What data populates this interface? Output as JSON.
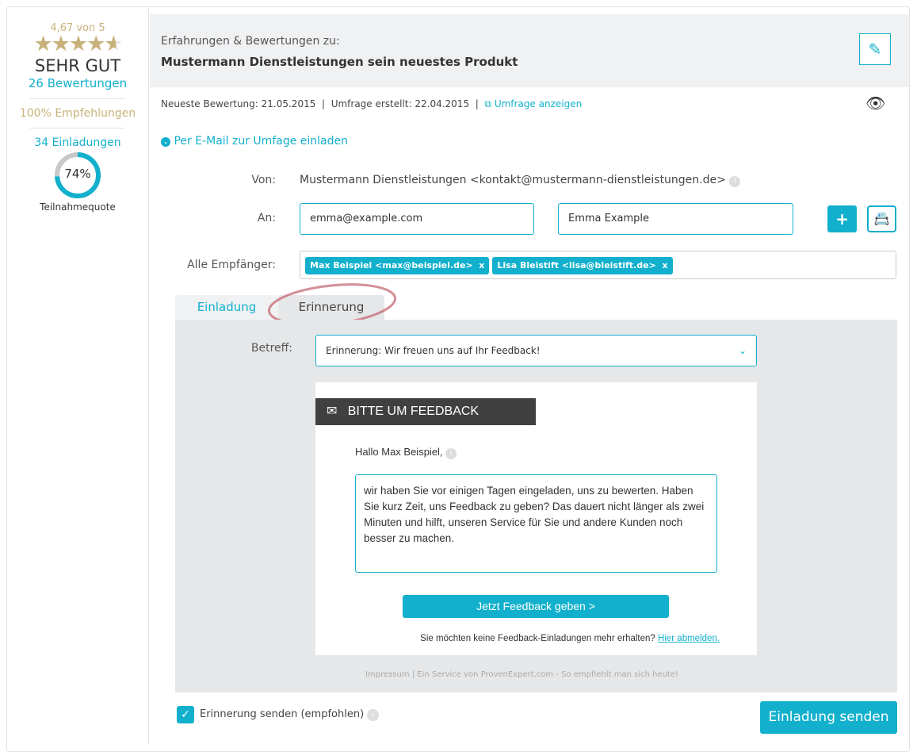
{
  "sidebar": {
    "score": "4,67 von 5",
    "rating_fraction": 0.934,
    "grade": "SEHR GUT",
    "reviews": "26 Bewertungen",
    "recommendations": "100% Empfehlungen",
    "invitations": "34 Einladungen",
    "participation_percent": 74,
    "participation_label": "74%",
    "participation_caption": "Teilnahmequote"
  },
  "header": {
    "subtitle": "Erfahrungen & Bewertungen zu:",
    "title": "Mustermann Dienstleistungen sein neuestes Produkt",
    "edit_icon": "pencil-icon"
  },
  "meta": {
    "latest": "Neueste Bewertung: 21.05.2015",
    "created": "Umfrage erstellt: 22.04.2015",
    "link": "Umfrage anzeigen",
    "sep": "|"
  },
  "invite_toggle": "Per E-Mail zur Umfage einladen",
  "form": {
    "from_label": "Von:",
    "from_value": "Mustermann Dienstleistungen <kontakt@mustermann-dienstleistungen.de>",
    "to_label": "An:",
    "email_value": "emma@example.com",
    "name_value": "Emma Example",
    "recipients_label": "Alle Empfänger:",
    "recipients": [
      {
        "label": "Max Beispiel <max@beispiel.de>",
        "remove": "x"
      },
      {
        "label": "Lisa Bleistift <lisa@bleistift.de>",
        "remove": "x"
      }
    ]
  },
  "tabs": [
    {
      "label": "Einladung"
    },
    {
      "label": "Erinnerung",
      "active": true
    }
  ],
  "subject": {
    "label": "Betreff:",
    "value": "Erinnerung: Wir freuen uns auf Ihr Feedback!"
  },
  "email": {
    "banner": "BITTE UM FEEDBACK",
    "greeting": "Hallo Max Beispiel,",
    "body": "wir haben Sie vor einigen Tagen eingeladen, uns zu bewerten. Haben Sie kurz Zeit, uns Feedback zu geben? Das dauert nicht länger als zwei Minuten und hilft, unseren Service für Sie und andere Kunden noch besser zu machen.",
    "cta": "Jetzt Feedback geben >",
    "unsubscribe_text": "Sie möchten keine Feedback-Einladungen mehr erhalten?",
    "unsubscribe_link": "Hier abmelden.",
    "footer": "Impressum | Ein Service von ProvenExpert.com - So empfiehlt man sich heute!"
  },
  "footer": {
    "reminder_label": "Erinnerung senden (empfohlen)",
    "reminder_checked": true,
    "send_button": "Einladung senden"
  },
  "colors": {
    "accent": "#12b0cc",
    "gold": "#c8b27a"
  }
}
